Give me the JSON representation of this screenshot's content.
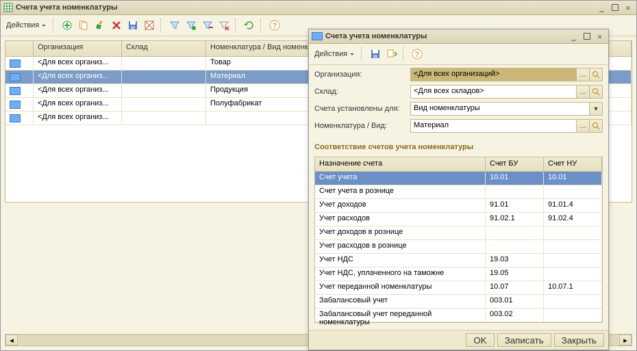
{
  "main": {
    "title": "Счета учета номенклатуры",
    "toolbar": {
      "actions": "Действия"
    },
    "grid": {
      "cols": [
        "",
        "Организация",
        "Склад",
        "Номенклатура / Вид номенклатуры"
      ],
      "rows": [
        {
          "org": "<Для всех организ...",
          "wh": "",
          "nom": "Товар",
          "sel": false
        },
        {
          "org": "<Для всех организ...",
          "wh": "",
          "nom": "Материал",
          "sel": true
        },
        {
          "org": "<Для всех организ...",
          "wh": "",
          "nom": "Продукция",
          "sel": false
        },
        {
          "org": "<Для всех организ...",
          "wh": "",
          "nom": "Полуфабрикат",
          "sel": false
        },
        {
          "org": "<Для всех организ...",
          "wh": "",
          "nom": "",
          "sel": false
        }
      ]
    }
  },
  "dlg": {
    "title": "Счета учета номенклатуры",
    "toolbar": {
      "actions": "Действия"
    },
    "form": {
      "org_label": "Организация:",
      "org_value": "<Для всех организаций>",
      "wh_label": "Склад:",
      "wh_value": "<Для всех складов>",
      "for_label": "Счета установлены для:",
      "for_value": "Вид номенклатуры",
      "nom_label": "Номенклатура / Вид:",
      "nom_value": "Материал"
    },
    "section": "Соответствие счетов учета номенклатуры",
    "sg": {
      "cols": [
        "Назначение счета",
        "Счет БУ",
        "Счет НУ"
      ],
      "rows": [
        {
          "n": "Счет учета",
          "bu": "10.01",
          "nu": "10.01",
          "sel": true
        },
        {
          "n": "Счет учета в рознице",
          "bu": "",
          "nu": ""
        },
        {
          "n": "Учет доходов",
          "bu": "91.01",
          "nu": "91.01.4"
        },
        {
          "n": "Учет расходов",
          "bu": "91.02.1",
          "nu": "91.02.4"
        },
        {
          "n": "Учет доходов в рознице",
          "bu": "",
          "nu": ""
        },
        {
          "n": "Учет расходов в рознице",
          "bu": "",
          "nu": ""
        },
        {
          "n": "Учет НДС",
          "bu": "19.03",
          "nu": ""
        },
        {
          "n": "Учет НДС, уплаченного на таможне",
          "bu": "19.05",
          "nu": ""
        },
        {
          "n": "Учет переданной номенклатуры",
          "bu": "10.07",
          "nu": "10.07.1"
        },
        {
          "n": "Забалансовый учет",
          "bu": "003.01",
          "nu": ""
        },
        {
          "n": "Забалансовый учет переданной номенклатуры",
          "bu": "003.02",
          "nu": ""
        }
      ]
    },
    "footer": {
      "ok": "OK",
      "save": "Записать",
      "close": "Закрыть"
    }
  },
  "icons": {
    "add": "#3aa53a",
    "copy": "#d6a034",
    "edit": "#3aa53a",
    "del": "#cc3333",
    "save": "#5a7bc1",
    "checks": "#c3653a",
    "filter": "#5a9bd5",
    "refresh": "#3aa53a",
    "help": "#e2a23a",
    "search": "#b58a1a"
  }
}
